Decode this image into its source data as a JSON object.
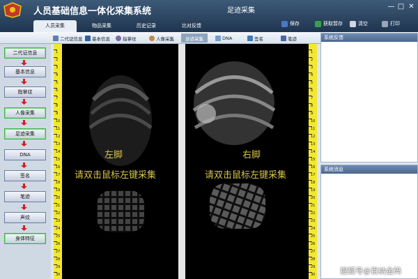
{
  "window": {
    "app_title": "人员基础信息一体化采集系统",
    "center_title": "足迹采集"
  },
  "tabs": [
    {
      "label": "人员采集",
      "active": true
    },
    {
      "label": "物品采集",
      "active": false
    },
    {
      "label": "历史记录",
      "active": false
    },
    {
      "label": "比对反馈",
      "active": false
    }
  ],
  "toolbar": {
    "save": "保存",
    "fetch_pause": "获取暂存",
    "clear": "清空",
    "print": "打印"
  },
  "subtoolbar": [
    {
      "label": "二代证信息",
      "active": false
    },
    {
      "label": "基本信息",
      "active": false
    },
    {
      "label": "指掌纹",
      "active": false
    },
    {
      "label": "人像采集",
      "active": false
    },
    {
      "label": "足迹采集",
      "active": true
    },
    {
      "label": "DNA",
      "active": false
    },
    {
      "label": "签名",
      "active": false
    },
    {
      "label": "笔迹",
      "active": false
    }
  ],
  "leftnav": [
    {
      "label": "二代证信息",
      "done": true
    },
    {
      "label": "基本信息",
      "done": false
    },
    {
      "label": "指掌纹",
      "done": false
    },
    {
      "label": "人像采集",
      "done": true
    },
    {
      "label": "足迹采集",
      "done": true
    },
    {
      "label": "DNA",
      "done": false
    },
    {
      "label": "签名",
      "done": false
    },
    {
      "label": "笔迹",
      "done": false
    },
    {
      "label": "声纹",
      "done": false
    },
    {
      "label": "身体特征",
      "done": true
    }
  ],
  "capture": {
    "left_label": "左脚",
    "right_label": "右脚",
    "prompt": "请双击鼠标左键采集"
  },
  "panels": {
    "feedback_title": "系统反馈",
    "message_title": "系统消息"
  },
  "ruler_numbers": [
    "1",
    "2",
    "3",
    "4",
    "5",
    "6",
    "7",
    "8",
    "9",
    "10",
    "11",
    "12",
    "13",
    "14",
    "15",
    "16",
    "17",
    "18",
    "19",
    "20",
    "21",
    "22",
    "23",
    "24",
    "25",
    "26",
    "27",
    "28",
    "29",
    "30"
  ],
  "watermark": "搜狐号@百纳金码"
}
